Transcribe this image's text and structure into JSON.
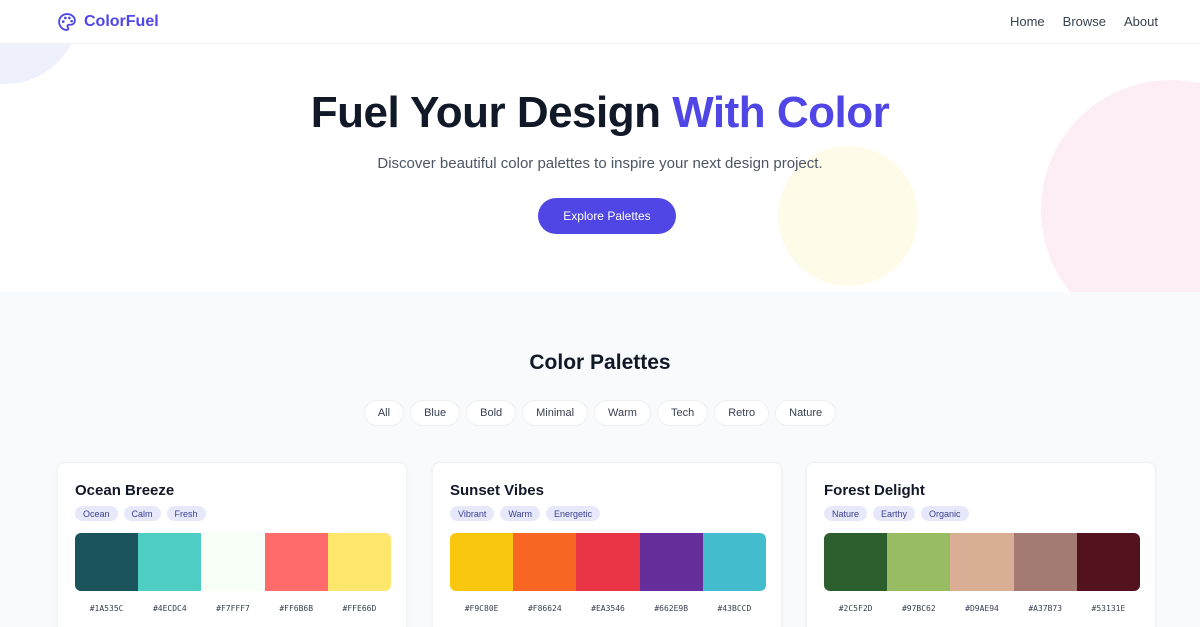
{
  "brand": {
    "name": "ColorFuel",
    "accent": "#4f46e5"
  },
  "nav": [
    {
      "label": "Home"
    },
    {
      "label": "Browse"
    },
    {
      "label": "About"
    }
  ],
  "hero": {
    "title_main": "Fuel Your Design ",
    "title_accent": "With Color",
    "subtitle": "Discover beautiful color palettes to inspire your next design project.",
    "cta": "Explore Palettes"
  },
  "palettes_section": {
    "title": "Color Palettes",
    "filters": [
      "All",
      "Blue",
      "Bold",
      "Minimal",
      "Warm",
      "Tech",
      "Retro",
      "Nature"
    ]
  },
  "palettes": [
    {
      "name": "Ocean Breeze",
      "tags": [
        "Ocean",
        "Calm",
        "Fresh"
      ],
      "colors": [
        "#1A535C",
        "#4ECDC4",
        "#F7FFF7",
        "#FF6B6B",
        "#FFE66D"
      ]
    },
    {
      "name": "Sunset Vibes",
      "tags": [
        "Vibrant",
        "Warm",
        "Energetic"
      ],
      "colors": [
        "#F9C80E",
        "#F86624",
        "#EA3546",
        "#662E9B",
        "#43BCCD"
      ]
    },
    {
      "name": "Forest Delight",
      "tags": [
        "Nature",
        "Earthy",
        "Organic"
      ],
      "colors": [
        "#2C5F2D",
        "#97BC62",
        "#D9AE94",
        "#A37B73",
        "#53131E"
      ]
    }
  ]
}
